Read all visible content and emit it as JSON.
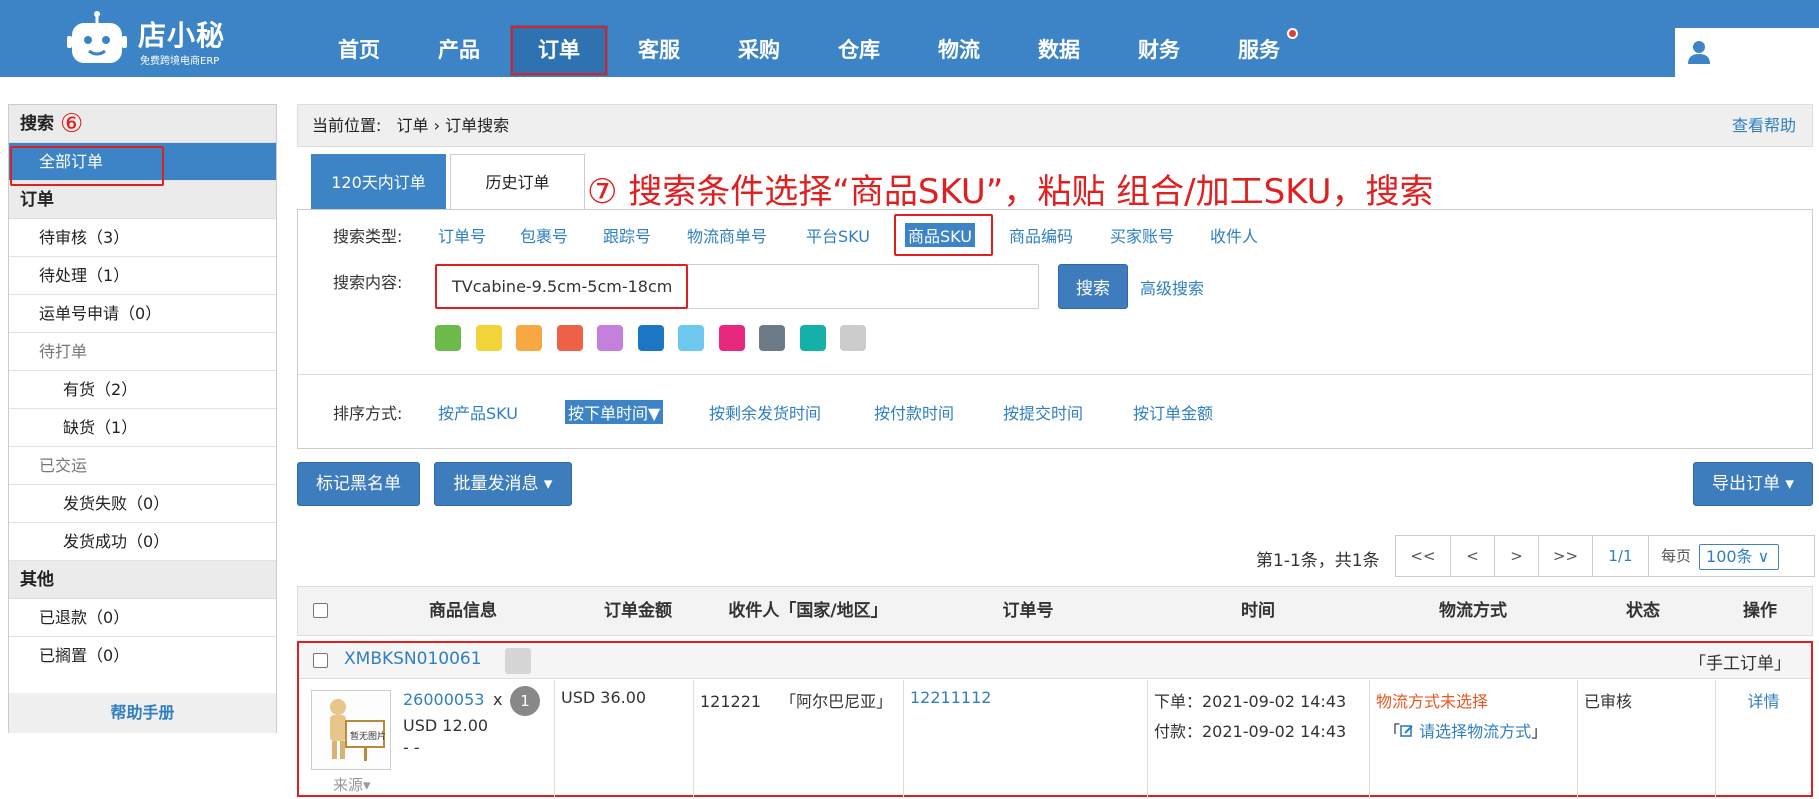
{
  "header": {
    "brand": "店小秘",
    "brand_sub": "免费跨境电商ERP",
    "nav": [
      "首页",
      "产品",
      "订单",
      "客服",
      "采购",
      "仓库",
      "物流",
      "数据",
      "财务",
      "服务"
    ],
    "active_nav": "订单"
  },
  "sidebar": {
    "search_head": "搜索",
    "anno_6": "⑥",
    "all_orders": "全部订单",
    "order_head": "订单",
    "items": [
      {
        "label": "待审核",
        "count": "（3）"
      },
      {
        "label": "待处理",
        "count": "（1）"
      },
      {
        "label": "运单号申请",
        "count": "（0）"
      },
      {
        "label": "待打单",
        "count": ""
      },
      {
        "label": "有货",
        "count": "（2）"
      },
      {
        "label": "缺货",
        "count": "（1）"
      },
      {
        "label": "已交运",
        "count": ""
      },
      {
        "label": "发货失败",
        "count": "（0）"
      },
      {
        "label": "发货成功",
        "count": "（0）"
      }
    ],
    "other_head": "其他",
    "other_items": [
      {
        "label": "已退款",
        "count": "（0）"
      },
      {
        "label": "已搁置",
        "count": "（0）"
      }
    ],
    "help_manual": "帮助手册"
  },
  "breadcrumb": {
    "prefix": "当前位置:",
    "path": "订单 › 订单搜索",
    "help": "查看帮助"
  },
  "tabs": [
    "120天内订单",
    "历史订单"
  ],
  "annotation_7": "⑦ 搜索条件选择“商品SKU”，粘贴 组合/加工SKU，搜索",
  "search": {
    "type_label": "搜索类型:",
    "types": [
      "订单号",
      "包裹号",
      "跟踪号",
      "物流商单号",
      "平台SKU",
      "商品SKU",
      "商品编码",
      "买家账号",
      "收件人"
    ],
    "selected_type": "商品SKU",
    "content_label": "搜索内容:",
    "value": "TVcabine-9.5cm-5cm-18cm",
    "button": "搜索",
    "advanced": "高级搜索",
    "colors": [
      "#6cbb4a",
      "#f1d43a",
      "#f7a843",
      "#ee6146",
      "#c57fdc",
      "#1b76c4",
      "#6cc8ef",
      "#e6287f",
      "#6b7c88",
      "#15b0a8",
      "#cccccc"
    ]
  },
  "sort": {
    "label": "排序方式:",
    "options": [
      "按产品SKU",
      "按下单时间▼",
      "按剩余发货时间",
      "按付款时间",
      "按提交时间",
      "按订单金额"
    ],
    "selected": "按下单时间▼"
  },
  "actions": {
    "blacklist": "标记黑名单",
    "batch_message": "批量发消息 ▾",
    "export": "导出订单 ▾"
  },
  "pager": {
    "info": "第1-1条，共1条",
    "first": "<<",
    "prev": "<",
    "next": ">",
    "last": ">>",
    "page": "1/1",
    "per_page_label": "每页",
    "per_page": "100条 ∨"
  },
  "table": {
    "columns": [
      "商品信息",
      "订单金额",
      "收件人「国家/地区」",
      "订单号",
      "时间",
      "物流方式",
      "状态",
      "操作"
    ]
  },
  "order": {
    "id": "XMBKSN010061",
    "type": "「手工订单」",
    "product_sku": "26000053",
    "times_sign": "x",
    "qty": "1",
    "unit_price": "USD 12.00",
    "dash": "- -",
    "source": "来源▾",
    "no_image": "暂无图片",
    "amount": "USD 36.00",
    "recipient": "121221",
    "country": "「阿尔巴尼亚」",
    "order_no": "12211112",
    "order_time": "下单：2021-09-02 14:43",
    "pay_time": "付款：2021-09-02 14:43",
    "logistics_status": "物流方式未选择",
    "logistics_action": "请选择物流方式",
    "status": "已审核",
    "op": "详情"
  }
}
